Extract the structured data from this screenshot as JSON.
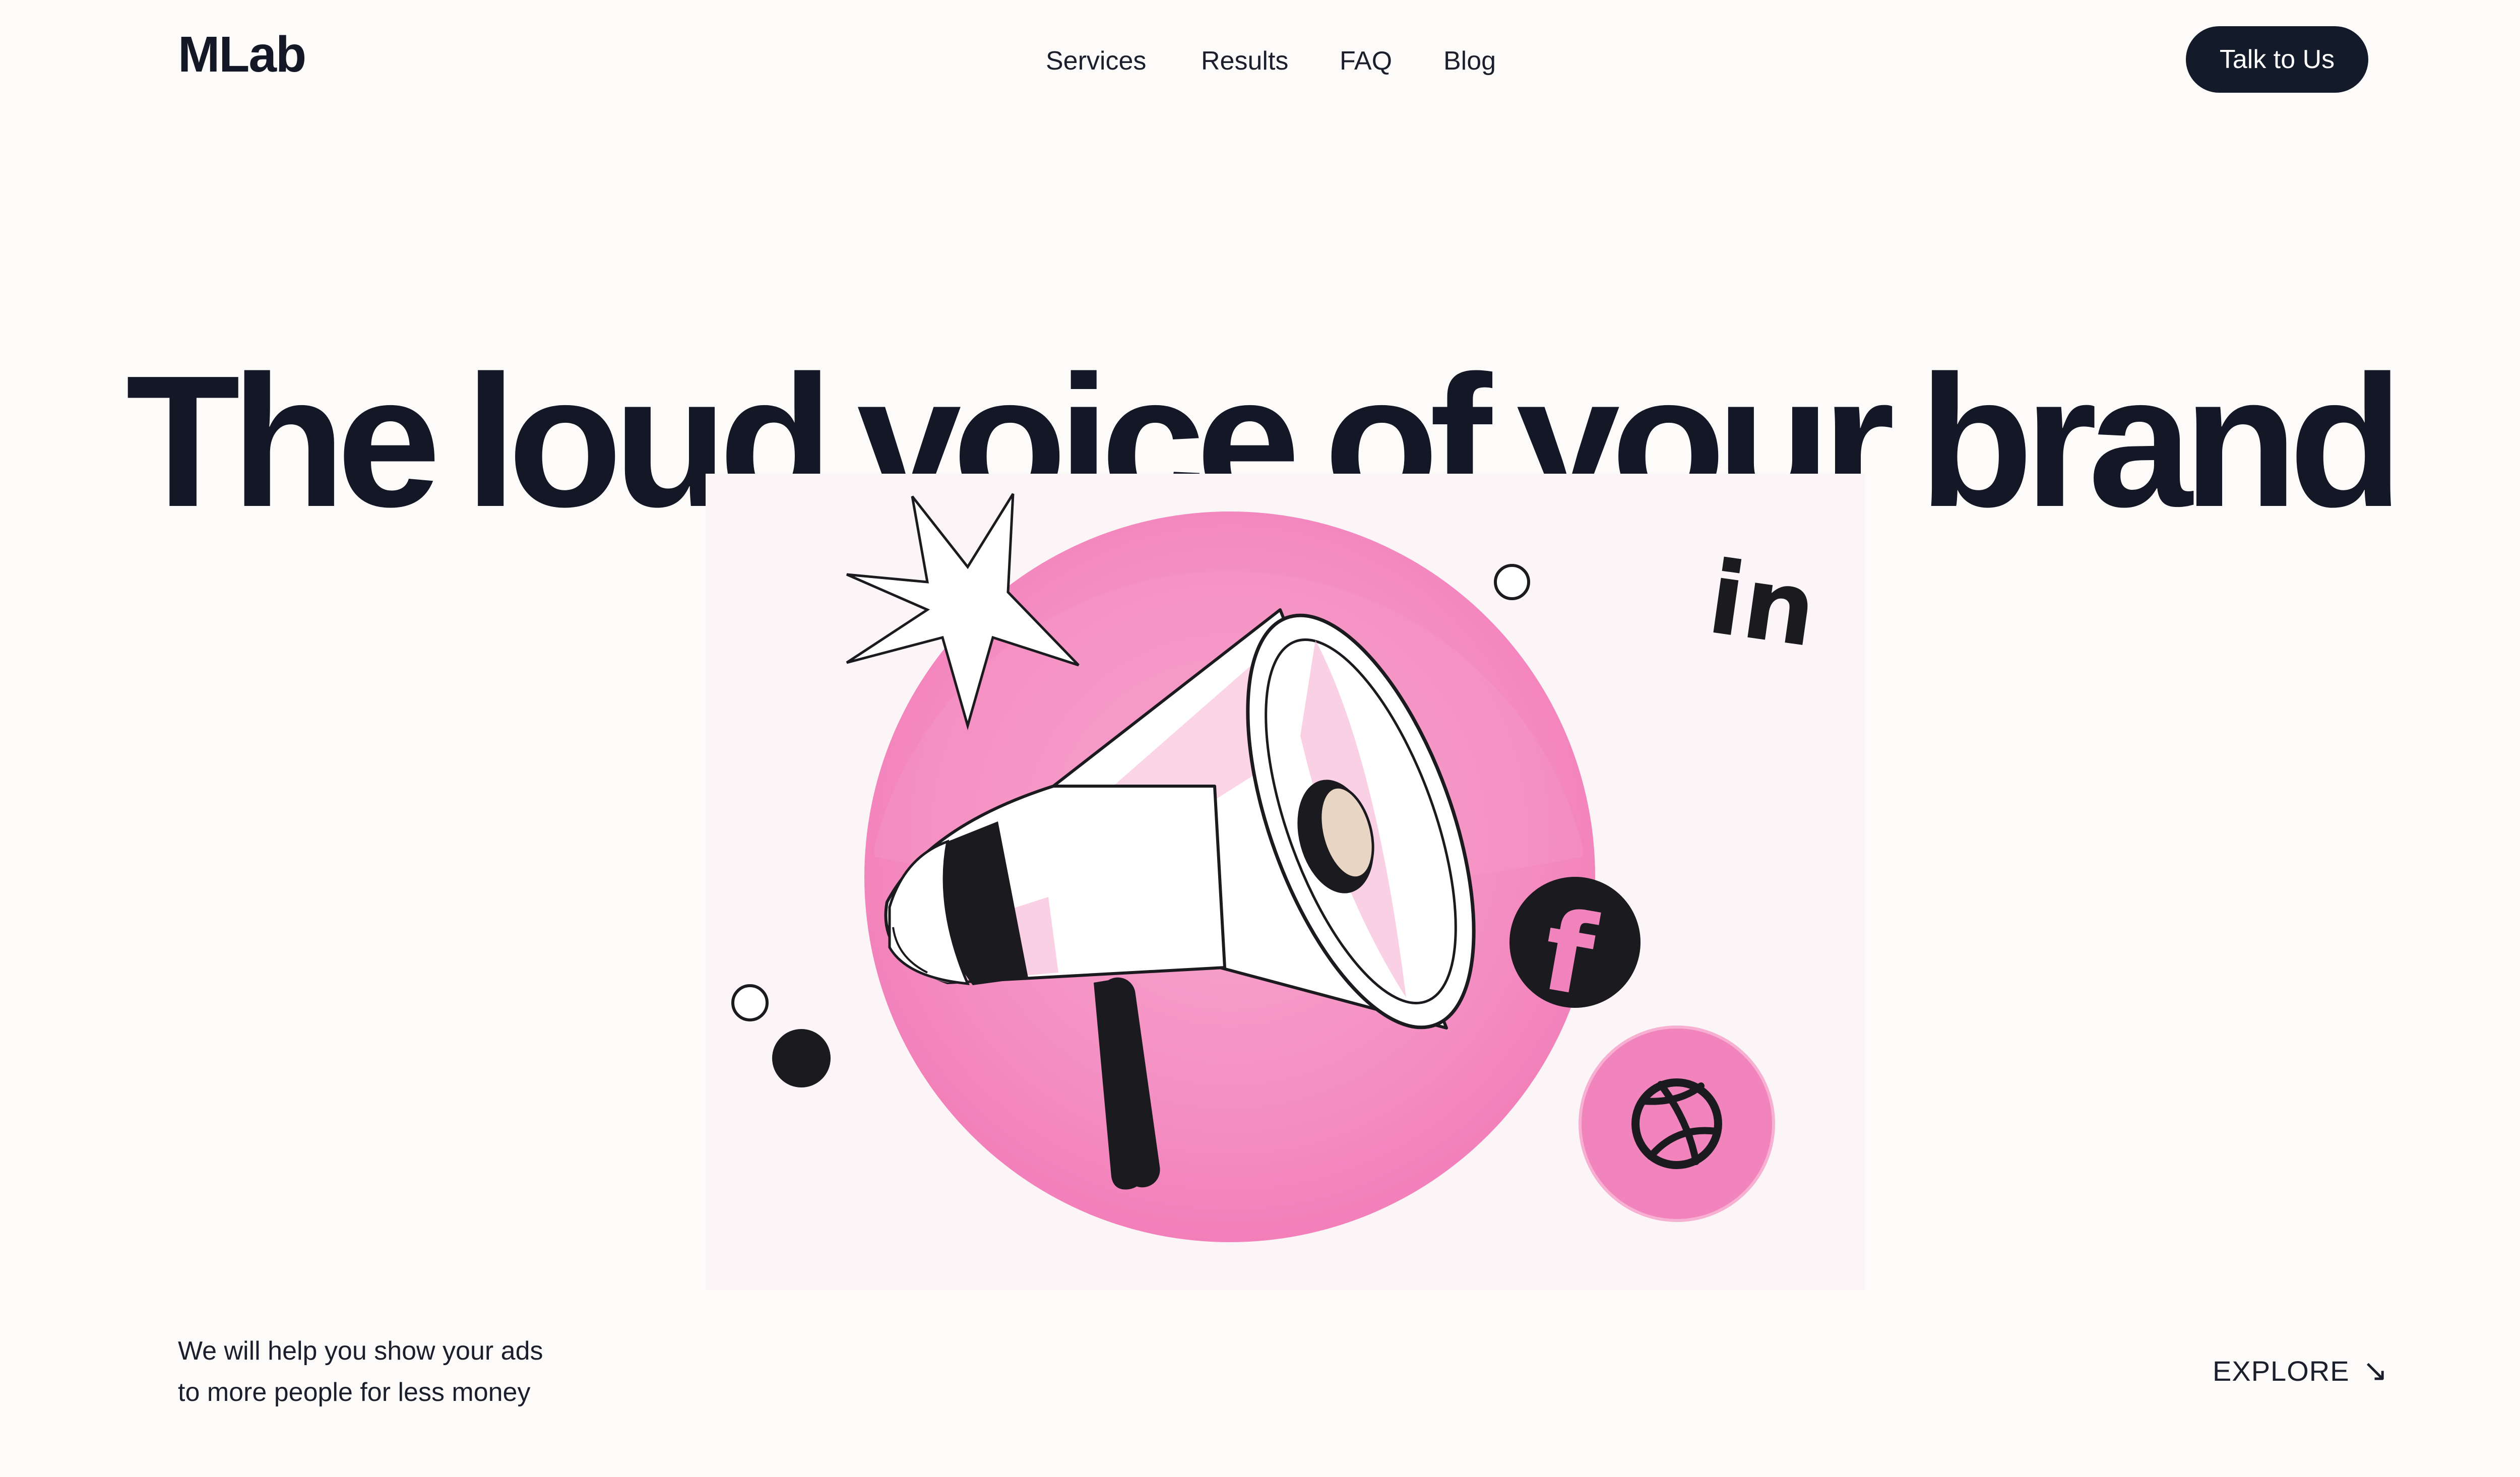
{
  "header": {
    "logo": "MLab",
    "nav": [
      {
        "label": "Services"
      },
      {
        "label": "Results"
      },
      {
        "label": "FAQ"
      },
      {
        "label": "Blog"
      }
    ],
    "cta_label": "Talk to Us"
  },
  "hero": {
    "title": "The loud voice of your brand"
  },
  "illustration": {
    "icons": [
      "megaphone-icon",
      "star-burst-icon",
      "linkedin-icon",
      "facebook-icon",
      "dribbble-icon"
    ],
    "colors": {
      "pink": "#f284bd",
      "pink_light": "#f5a3cb",
      "ink": "#1b1b1f"
    },
    "linkedin_text": "in",
    "facebook_text": "f"
  },
  "footer": {
    "tagline_line1": "We will help you show your ads",
    "tagline_line2": "to more people for less money",
    "explore_label": "EXPLORE",
    "explore_arrow": "↘"
  }
}
